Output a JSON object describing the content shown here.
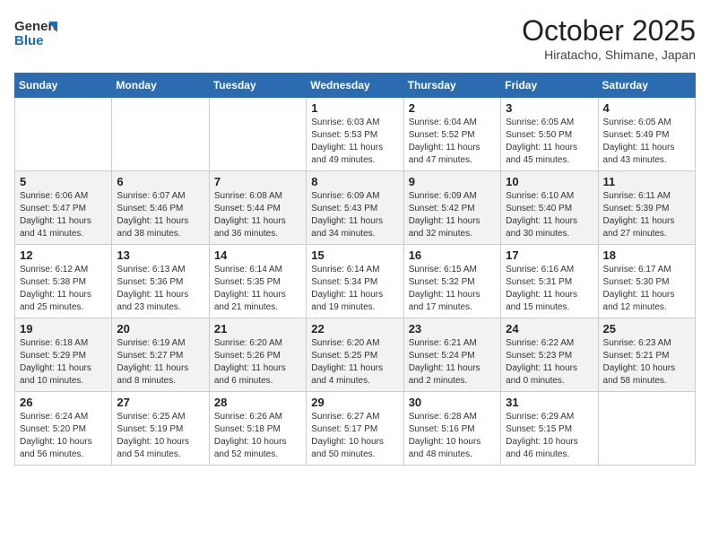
{
  "header": {
    "logo_line1": "General",
    "logo_line2": "Blue",
    "title": "October 2025",
    "subtitle": "Hiratacho, Shimane, Japan"
  },
  "weekdays": [
    "Sunday",
    "Monday",
    "Tuesday",
    "Wednesday",
    "Thursday",
    "Friday",
    "Saturday"
  ],
  "weeks": [
    [
      {
        "day": "",
        "info": ""
      },
      {
        "day": "",
        "info": ""
      },
      {
        "day": "",
        "info": ""
      },
      {
        "day": "1",
        "info": "Sunrise: 6:03 AM\nSunset: 5:53 PM\nDaylight: 11 hours\nand 49 minutes."
      },
      {
        "day": "2",
        "info": "Sunrise: 6:04 AM\nSunset: 5:52 PM\nDaylight: 11 hours\nand 47 minutes."
      },
      {
        "day": "3",
        "info": "Sunrise: 6:05 AM\nSunset: 5:50 PM\nDaylight: 11 hours\nand 45 minutes."
      },
      {
        "day": "4",
        "info": "Sunrise: 6:05 AM\nSunset: 5:49 PM\nDaylight: 11 hours\nand 43 minutes."
      }
    ],
    [
      {
        "day": "5",
        "info": "Sunrise: 6:06 AM\nSunset: 5:47 PM\nDaylight: 11 hours\nand 41 minutes."
      },
      {
        "day": "6",
        "info": "Sunrise: 6:07 AM\nSunset: 5:46 PM\nDaylight: 11 hours\nand 38 minutes."
      },
      {
        "day": "7",
        "info": "Sunrise: 6:08 AM\nSunset: 5:44 PM\nDaylight: 11 hours\nand 36 minutes."
      },
      {
        "day": "8",
        "info": "Sunrise: 6:09 AM\nSunset: 5:43 PM\nDaylight: 11 hours\nand 34 minutes."
      },
      {
        "day": "9",
        "info": "Sunrise: 6:09 AM\nSunset: 5:42 PM\nDaylight: 11 hours\nand 32 minutes."
      },
      {
        "day": "10",
        "info": "Sunrise: 6:10 AM\nSunset: 5:40 PM\nDaylight: 11 hours\nand 30 minutes."
      },
      {
        "day": "11",
        "info": "Sunrise: 6:11 AM\nSunset: 5:39 PM\nDaylight: 11 hours\nand 27 minutes."
      }
    ],
    [
      {
        "day": "12",
        "info": "Sunrise: 6:12 AM\nSunset: 5:38 PM\nDaylight: 11 hours\nand 25 minutes."
      },
      {
        "day": "13",
        "info": "Sunrise: 6:13 AM\nSunset: 5:36 PM\nDaylight: 11 hours\nand 23 minutes."
      },
      {
        "day": "14",
        "info": "Sunrise: 6:14 AM\nSunset: 5:35 PM\nDaylight: 11 hours\nand 21 minutes."
      },
      {
        "day": "15",
        "info": "Sunrise: 6:14 AM\nSunset: 5:34 PM\nDaylight: 11 hours\nand 19 minutes."
      },
      {
        "day": "16",
        "info": "Sunrise: 6:15 AM\nSunset: 5:32 PM\nDaylight: 11 hours\nand 17 minutes."
      },
      {
        "day": "17",
        "info": "Sunrise: 6:16 AM\nSunset: 5:31 PM\nDaylight: 11 hours\nand 15 minutes."
      },
      {
        "day": "18",
        "info": "Sunrise: 6:17 AM\nSunset: 5:30 PM\nDaylight: 11 hours\nand 12 minutes."
      }
    ],
    [
      {
        "day": "19",
        "info": "Sunrise: 6:18 AM\nSunset: 5:29 PM\nDaylight: 11 hours\nand 10 minutes."
      },
      {
        "day": "20",
        "info": "Sunrise: 6:19 AM\nSunset: 5:27 PM\nDaylight: 11 hours\nand 8 minutes."
      },
      {
        "day": "21",
        "info": "Sunrise: 6:20 AM\nSunset: 5:26 PM\nDaylight: 11 hours\nand 6 minutes."
      },
      {
        "day": "22",
        "info": "Sunrise: 6:20 AM\nSunset: 5:25 PM\nDaylight: 11 hours\nand 4 minutes."
      },
      {
        "day": "23",
        "info": "Sunrise: 6:21 AM\nSunset: 5:24 PM\nDaylight: 11 hours\nand 2 minutes."
      },
      {
        "day": "24",
        "info": "Sunrise: 6:22 AM\nSunset: 5:23 PM\nDaylight: 11 hours\nand 0 minutes."
      },
      {
        "day": "25",
        "info": "Sunrise: 6:23 AM\nSunset: 5:21 PM\nDaylight: 10 hours\nand 58 minutes."
      }
    ],
    [
      {
        "day": "26",
        "info": "Sunrise: 6:24 AM\nSunset: 5:20 PM\nDaylight: 10 hours\nand 56 minutes."
      },
      {
        "day": "27",
        "info": "Sunrise: 6:25 AM\nSunset: 5:19 PM\nDaylight: 10 hours\nand 54 minutes."
      },
      {
        "day": "28",
        "info": "Sunrise: 6:26 AM\nSunset: 5:18 PM\nDaylight: 10 hours\nand 52 minutes."
      },
      {
        "day": "29",
        "info": "Sunrise: 6:27 AM\nSunset: 5:17 PM\nDaylight: 10 hours\nand 50 minutes."
      },
      {
        "day": "30",
        "info": "Sunrise: 6:28 AM\nSunset: 5:16 PM\nDaylight: 10 hours\nand 48 minutes."
      },
      {
        "day": "31",
        "info": "Sunrise: 6:29 AM\nSunset: 5:15 PM\nDaylight: 10 hours\nand 46 minutes."
      },
      {
        "day": "",
        "info": ""
      }
    ]
  ]
}
